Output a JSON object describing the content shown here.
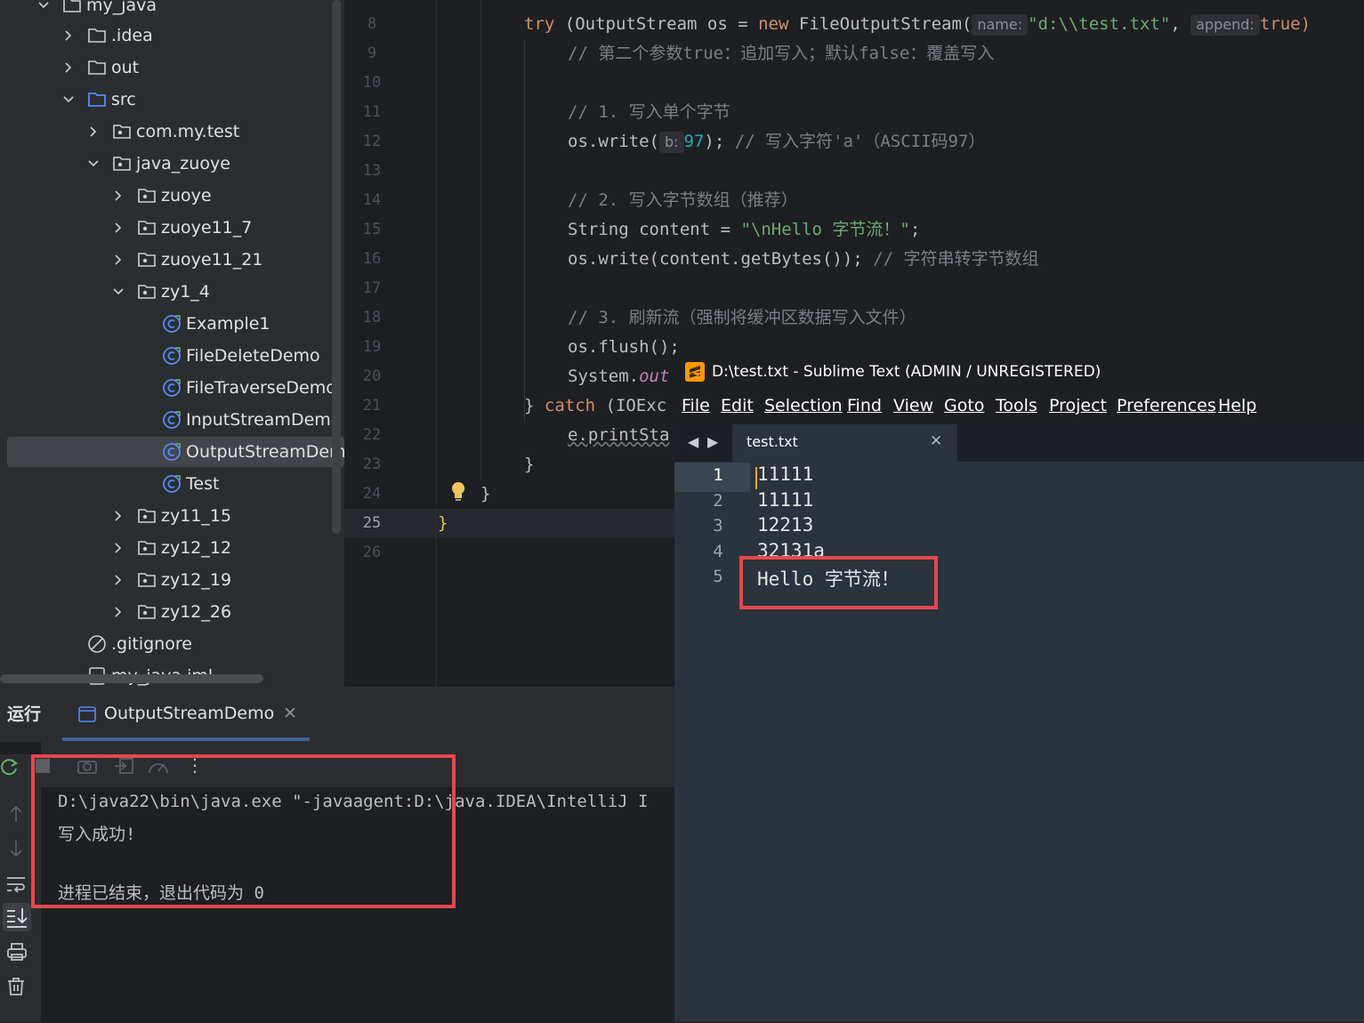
{
  "project_tree": {
    "items": [
      {
        "label": "my_java",
        "icon": "folder-icon",
        "expanded": true
      },
      {
        "label": ".idea",
        "icon": "folder-icon",
        "expanded": false
      },
      {
        "label": "out",
        "icon": "folder-icon",
        "expanded": false
      },
      {
        "label": "src",
        "icon": "source-folder-icon",
        "expanded": true
      },
      {
        "label": "com.my.test",
        "icon": "package-icon",
        "expanded": false
      },
      {
        "label": "java_zuoye",
        "icon": "package-icon",
        "expanded": true
      },
      {
        "label": "zuoye",
        "icon": "package-icon",
        "expanded": false
      },
      {
        "label": "zuoye11_7",
        "icon": "package-icon",
        "expanded": false
      },
      {
        "label": "zuoye11_21",
        "icon": "package-icon",
        "expanded": false
      },
      {
        "label": "zy1_4",
        "icon": "package-icon",
        "expanded": true
      },
      {
        "label": "Example1",
        "icon": "class-icon"
      },
      {
        "label": "FileDeleteDemo",
        "icon": "class-icon"
      },
      {
        "label": "FileTraverseDemo",
        "icon": "class-icon"
      },
      {
        "label": "InputStreamDemo",
        "icon": "class-icon"
      },
      {
        "label": "OutputStreamDemo",
        "icon": "class-icon",
        "selected": true
      },
      {
        "label": "Test",
        "icon": "class-icon"
      },
      {
        "label": "zy11_15",
        "icon": "package-icon",
        "expanded": false
      },
      {
        "label": "zy12_12",
        "icon": "package-icon",
        "expanded": false
      },
      {
        "label": "zy12_19",
        "icon": "package-icon",
        "expanded": false
      },
      {
        "label": "zy12_26",
        "icon": "package-icon",
        "expanded": false
      },
      {
        "label": ".gitignore",
        "icon": "ignore-file-icon"
      },
      {
        "label": "my_java.iml",
        "icon": "module-file-icon"
      }
    ]
  },
  "editor": {
    "line_numbers": [
      "8",
      "9",
      "10",
      "11",
      "12",
      "13",
      "14",
      "15",
      "16",
      "17",
      "18",
      "19",
      "20",
      "21",
      "22",
      "23",
      "24",
      "25",
      "26"
    ],
    "current_line": "25",
    "lines": {
      "l8_try": "try",
      "l8_a": " (OutputStream os = ",
      "l8_new": "new",
      "l8_b": " FileOutputStream(",
      "l8_hint_name": "name:",
      "l8_str": "\"d:\\\\test.txt\"",
      "l8_c": ",",
      "l8_hint_append": "append:",
      "l8_true": "true)",
      "l9": "// 第二个参数true：追加写入；默认false：覆盖写入",
      "l11": "// 1. 写入单个字节",
      "l12_a": "os.write(",
      "l12_hint": "b:",
      "l12_num": "97",
      "l12_b": "); ",
      "l12_cm": "// 写入字符'a'（ASCII码97）",
      "l14": "// 2. 写入字节数组（推荐）",
      "l15_a": "String content = ",
      "l15_str": "\"\\nHello 字节流！\"",
      "l15_b": ";",
      "l16_a": "os.write(content.getBytes()); ",
      "l16_cm": "// 字符串转字节数组",
      "l18": "// 3. 刷新流（强制将缓冲区数据写入文件）",
      "l19": "os.flush();",
      "l20_a": "System.",
      "l20_out": "out",
      "l21_a": "} ",
      "l21_catch": "catch",
      "l21_b": " (IOExc",
      "l22": "e.printSta",
      "l23": "}",
      "l24": "}",
      "l25": "}"
    }
  },
  "run_panel": {
    "title": "运行",
    "tab_label": "OutputStreamDemo",
    "console": [
      "D:\\java22\\bin\\java.exe \"-javaagent:D:\\java.IDEA\\IntelliJ I",
      "写入成功!",
      "",
      "进程已结束，退出代码为 0"
    ]
  },
  "sublime": {
    "title": "D:\\test.txt - Sublime Text (ADMIN / UNREGISTERED)",
    "menu": [
      "File",
      "Edit",
      "Selection",
      "Find",
      "View",
      "Goto",
      "Tools",
      "Project",
      "Preferences",
      "Help"
    ],
    "tab_label": "test.txt",
    "line_numbers": [
      "1",
      "2",
      "3",
      "4",
      "5"
    ],
    "lines": [
      "11111",
      "11111",
      "12213",
      "32131a",
      "Hello 字节流！"
    ]
  },
  "colors": {
    "highlight_box": "#e5484d",
    "keyword": "#cf8e6d",
    "string": "#6aab73",
    "comment": "#7a7e85"
  }
}
